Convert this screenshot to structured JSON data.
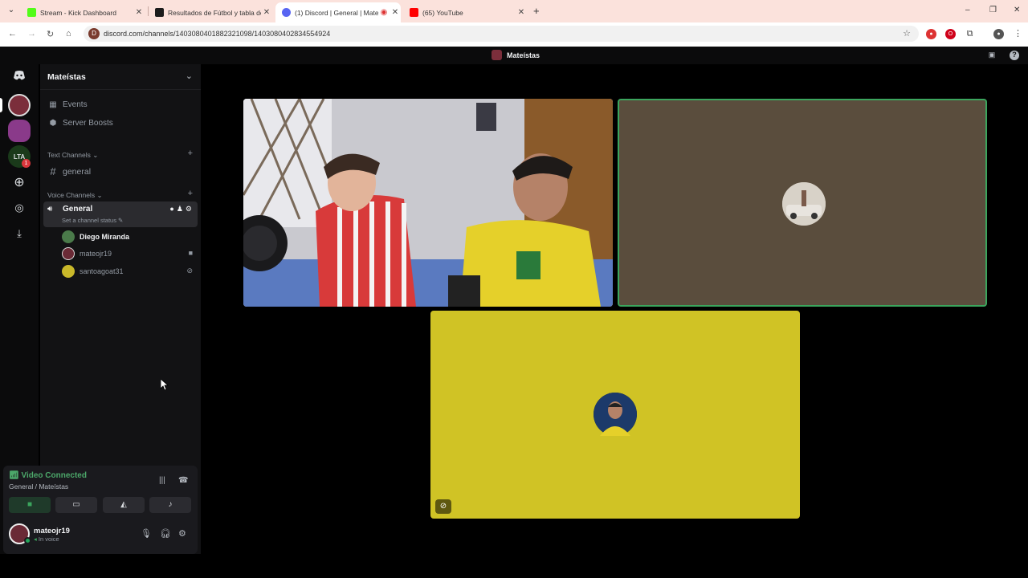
{
  "browser": {
    "tabs": [
      {
        "title": "Stream - Kick Dashboard",
        "favicon_color": "#53fc18",
        "active": false
      },
      {
        "title": "Resultados de Fútbol y tabla de",
        "favicon_color": "#1b1b1b",
        "active": false
      },
      {
        "title": "(1) Discord | General | Mate",
        "favicon_color": "#5865f2",
        "active": true
      },
      {
        "title": "(65) YouTube",
        "favicon_color": "#ff0000",
        "active": false
      }
    ],
    "url": "discord.com/channels/1403080401882321098/1403080402834554924",
    "new_tab_label": "+",
    "window_controls": [
      "–",
      "❐",
      "✕"
    ]
  },
  "discord": {
    "window_title": "Mateístas",
    "server_rail": [
      {
        "icon": "discord-home-icon"
      },
      {
        "icon": "server-mateistas",
        "active": true
      },
      {
        "icon": "server-2"
      },
      {
        "icon": "server-lta",
        "label": "LTA",
        "badge": "1"
      },
      {
        "icon": "add-server-icon"
      },
      {
        "icon": "discover-icon"
      },
      {
        "icon": "download-icon"
      }
    ],
    "guild_name": "Mateístas",
    "sidebar_top": [
      {
        "label": "Events",
        "icon": "calendar-icon"
      },
      {
        "label": "Server Boosts",
        "icon": "boost-icon"
      }
    ],
    "text_category": "Text Channels",
    "text_channels": [
      {
        "label": "general",
        "icon": "hash-icon"
      }
    ],
    "voice_category": "Voice Channels",
    "voice_channel": {
      "name": "General",
      "status_placeholder": "Set a channel status"
    },
    "voice_members": [
      {
        "name": "Diego Miranda",
        "color": "#f2f3f5",
        "avatar_color": "#4a7a4a",
        "bold": true,
        "icon": ""
      },
      {
        "name": "mateojr19",
        "color": "#949ba4",
        "avatar_color": "#6a2a36",
        "bold": false,
        "icon": "camera-icon"
      },
      {
        "name": "santoagoat31",
        "color": "#949ba4",
        "avatar_color": "#c9b82a",
        "bold": false,
        "icon": "mic-muted-icon"
      }
    ],
    "voice_panel": {
      "status": "Video Connected",
      "location": "General / Mateístas"
    },
    "user": {
      "name": "mateojr19",
      "status": "In voice"
    },
    "accent_green": "#3ba55d",
    "tiles": [
      {
        "type": "camera",
        "label": "camera-feed"
      },
      {
        "type": "avatar",
        "bg": "#5a4d3d",
        "speaking": true
      },
      {
        "type": "avatar",
        "bg": "#d0c325",
        "muted": true
      }
    ]
  }
}
